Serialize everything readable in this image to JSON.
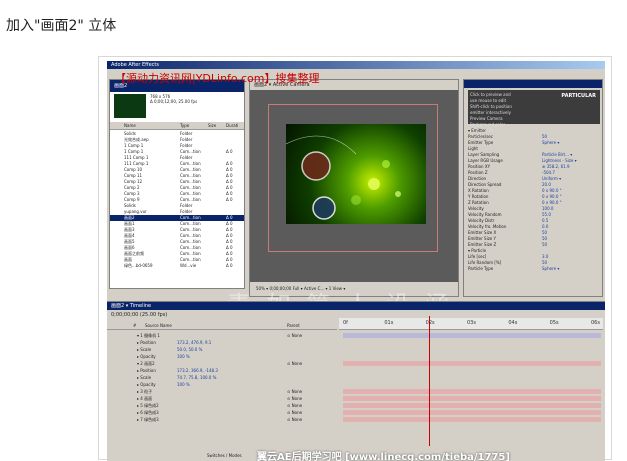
{
  "page": {
    "heading": "加入\"画面2\" 立体"
  },
  "app": {
    "title": "Adobe After Effects"
  },
  "watermarks": {
    "top": "【源动力资讯网|YDLinfo.com】搜集整理",
    "center": "素 如 简 人 设 涵",
    "bottom": "翼云AE后期学习吧 [www.linecg.com/tieba/1775]"
  },
  "project": {
    "comp_name": "画面2",
    "info": [
      "768 x 576",
      "Δ 0;00;12;00, 25.00 fps"
    ],
    "columns": {
      "name": "Name",
      "type": "Type",
      "size": "Size",
      "duration": "Durati"
    },
    "items": [
      {
        "name": "Solids",
        "type": "Folder",
        "dur": ""
      },
      {
        "name": "光效合成.aep",
        "type": "Folder",
        "dur": ""
      },
      {
        "name": "1 Comp 1",
        "type": "Folder",
        "dur": ""
      },
      {
        "name": "1 Comp 1",
        "type": "Com...tion",
        "dur": "Δ 0"
      },
      {
        "name": "111 Comp 1",
        "type": "Folder",
        "dur": ""
      },
      {
        "name": "111 Comp 1",
        "type": "Com...tion",
        "dur": "Δ 0"
      },
      {
        "name": "Comp 10",
        "type": "Com...tion",
        "dur": "Δ 0"
      },
      {
        "name": "Comp 11",
        "type": "Com...tion",
        "dur": "Δ 0"
      },
      {
        "name": "Comp 12",
        "type": "Com...tion",
        "dur": "Δ 0"
      },
      {
        "name": "Comp 2",
        "type": "Com...tion",
        "dur": "Δ 0"
      },
      {
        "name": "Comp 3",
        "type": "Com...tion",
        "dur": "Δ 0"
      },
      {
        "name": "Comp 9",
        "type": "Com...tion",
        "dur": "Δ 0"
      },
      {
        "name": "Solids",
        "type": "Folder",
        "dur": ""
      },
      {
        "name": "yupang.vur",
        "type": "Folder",
        "dur": ""
      },
      {
        "name": "画面2",
        "type": "Com...tion",
        "dur": "Δ 0",
        "selected": true
      },
      {
        "name": "画面1",
        "type": "Com...tion",
        "dur": "Δ 0"
      },
      {
        "name": "画面3",
        "type": "Com...tion",
        "dur": "Δ 0"
      },
      {
        "name": "画面4",
        "type": "Com...tion",
        "dur": "Δ 0"
      },
      {
        "name": "画面5",
        "type": "Com...tion",
        "dur": "Δ 0"
      },
      {
        "name": "画面6",
        "type": "Com...tion",
        "dur": "Δ 0"
      },
      {
        "name": "画面之前频",
        "type": "Com...tion",
        "dur": "Δ 0"
      },
      {
        "name": "画面",
        "type": "Com...tion",
        "dur": "Δ 0"
      },
      {
        "name": "绿色...bd-0659",
        "type": "Wd...vie",
        "dur": "Δ 0"
      }
    ]
  },
  "comp_viewer": {
    "tab": "画面2 ▾  Active Camera",
    "bottom": "50%  ▾   0;00;00;00   Full  ▾   Active C... ▾  1 View ▾"
  },
  "effect_controls": {
    "logo": "PARTICULAR",
    "banner_lines": [
      "Click to preview and",
      "use mouse to edit",
      "Shift-click to position",
      "emitter interactively",
      "Preview Camera",
      "Background color",
      "Licensed to",
      "Cinex"
    ],
    "rows": [
      {
        "name": "▾ Emitter",
        "value": ""
      },
      {
        "name": "  Particles/sec",
        "value": "50"
      },
      {
        "name": "  Emitter Type",
        "value": "Sphere ▾"
      },
      {
        "name": "  Light",
        "value": ""
      },
      {
        "name": "  Layer Sampling",
        "value": "Particle Birt... ▾"
      },
      {
        "name": "  Layer RGB Usage",
        "value": "Lightness - Size ▾"
      },
      {
        "name": "  Position XY",
        "value": "⊕ 358.2, 61.9"
      },
      {
        "name": "  Position Z",
        "value": "-504.7"
      },
      {
        "name": "  Direction",
        "value": "Uniform ▾"
      },
      {
        "name": "  Direction Spread",
        "value": "20.0"
      },
      {
        "name": "  X Rotation",
        "value": "0 x 90.0 °"
      },
      {
        "name": "  Y Rotation",
        "value": "0 x 90.0 °"
      },
      {
        "name": "  Z Rotation",
        "value": "0 x 90.0 °"
      },
      {
        "name": "  Velocity",
        "value": "100.0"
      },
      {
        "name": "  Velocity Random",
        "value": "55.0"
      },
      {
        "name": "  Velocity Distr",
        "value": "0.5"
      },
      {
        "name": "  Velocity fro..Motion",
        "value": "0.0"
      },
      {
        "name": "  Emitter Size X",
        "value": "50"
      },
      {
        "name": "  Emitter Size Y",
        "value": "50"
      },
      {
        "name": "  Emitter Size Z",
        "value": "50"
      },
      {
        "name": "▾ Particle",
        "value": ""
      },
      {
        "name": "  Life [sec]",
        "value": "3.0"
      },
      {
        "name": "  Life Random [%]",
        "value": "50"
      },
      {
        "name": "  Particle Type",
        "value": "Sphere ▾"
      }
    ]
  },
  "timeline": {
    "tab": "画面2 ▾ Timeline",
    "time": "0;00;00;00 (25.00 fps)",
    "columns": {
      "num": "#",
      "source": "Source Name",
      "parent": "Parent"
    },
    "ruler": [
      "0f",
      "01s",
      "02s",
      "03s",
      "04s",
      "05s",
      "06s"
    ],
    "rows": [
      {
        "label": "▾ 1  摄像机 1",
        "value": "",
        "parent": "⊙ None",
        "bar": true,
        "selected": true
      },
      {
        "label": "   ▸ Position",
        "value": "173.2, 476.9, 9.1",
        "parent": "",
        "bar": false
      },
      {
        "label": "   ▸ Scale",
        "value": "50.0, 50.0 %",
        "parent": "",
        "bar": false
      },
      {
        "label": "   ▸ Opacity",
        "value": "100 %",
        "parent": "",
        "bar": false
      },
      {
        "label": "▾ 2  画面2",
        "value": "",
        "parent": "⊙ None",
        "bar": true
      },
      {
        "label": "   ▸ Position",
        "value": "173.2, 366.9, -148.3",
        "parent": "",
        "bar": false
      },
      {
        "label": "   ▸ Scale",
        "value": "74.7, 75.8, 100.0 %",
        "parent": "",
        "bar": false
      },
      {
        "label": "   ▸ Opacity",
        "value": "100 %",
        "parent": "",
        "bar": false
      },
      {
        "label": "▸ 3  粒子",
        "value": "",
        "parent": "⊙ None",
        "bar": true
      },
      {
        "label": "▸ 4  画面",
        "value": "",
        "parent": "⊙ None",
        "bar": true
      },
      {
        "label": "▸ 5  绿色成2",
        "value": "",
        "parent": "⊙ None",
        "bar": true
      },
      {
        "label": "▸ 6  绿色成3",
        "value": "",
        "parent": "⊙ None",
        "bar": true
      },
      {
        "label": "▸ 7  绿色成3",
        "value": "",
        "parent": "⊙ None",
        "bar": true
      }
    ],
    "footer": "Switches / Modes"
  }
}
